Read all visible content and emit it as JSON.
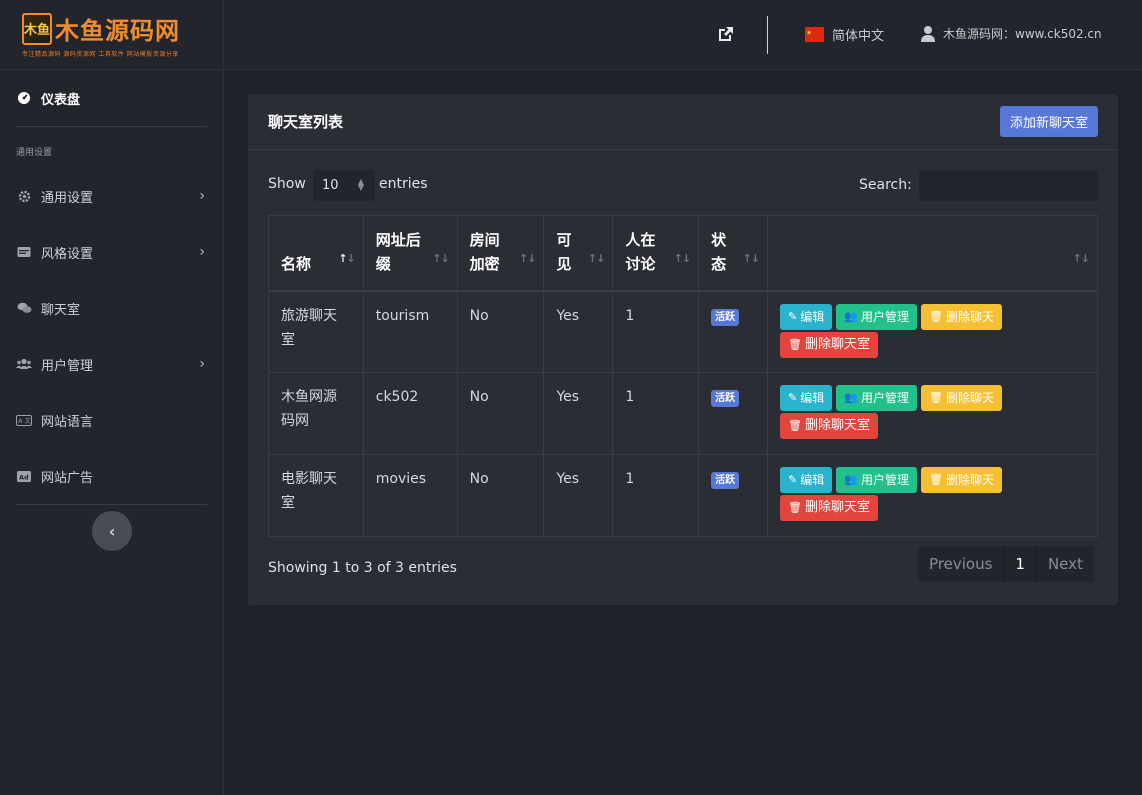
{
  "logo": {
    "badge": "木鱼",
    "text": "木鱼源码网",
    "subtitle": "专注精品源码 源码资源网 工具软件 网站模板资源分享"
  },
  "sidebar": {
    "dashboard": "仪表盘",
    "section": "通用设置",
    "items": [
      {
        "label": "通用设置",
        "icon": "gear-icon",
        "has_children": true
      },
      {
        "label": "风格设置",
        "icon": "palette-icon",
        "has_children": true
      },
      {
        "label": "聊天室",
        "icon": "chat-icon",
        "has_children": false
      },
      {
        "label": "用户管理",
        "icon": "users-icon",
        "has_children": true
      },
      {
        "label": "网站语言",
        "icon": "language-icon",
        "has_children": false
      },
      {
        "label": "网站广告",
        "icon": "ad-icon",
        "has_children": false
      }
    ],
    "collapse_glyph": "‹"
  },
  "header": {
    "language": "简体中文",
    "user": "木鱼源码网：www.ck502.cn"
  },
  "card": {
    "title": "聊天室列表",
    "add_button": "添加新聊天室"
  },
  "controls": {
    "show": "Show",
    "entries_value": "10",
    "entries": "entries",
    "search": "Search:"
  },
  "table": {
    "columns": [
      "名称",
      "网址后缀",
      "房间加密",
      "可见",
      "人在讨论",
      "状态",
      ""
    ],
    "columns_display": [
      [
        "名称"
      ],
      [
        "网址后",
        "缀"
      ],
      [
        "房间",
        "加密"
      ],
      [
        "可",
        "见"
      ],
      [
        "人在",
        "讨论"
      ],
      [
        "状",
        "态"
      ],
      [
        ""
      ]
    ],
    "rows": [
      {
        "name": [
          "旅游聊天",
          "室"
        ],
        "slug": "tourism",
        "encrypted": "No",
        "visible": "Yes",
        "online": "1",
        "status": "活跃"
      },
      {
        "name": [
          "木鱼网源",
          "码网"
        ],
        "slug": "ck502",
        "encrypted": "No",
        "visible": "Yes",
        "online": "1",
        "status": "活跃"
      },
      {
        "name": [
          "电影聊天",
          "室"
        ],
        "slug": "movies",
        "encrypted": "No",
        "visible": "Yes",
        "online": "1",
        "status": "活跃"
      }
    ],
    "actions": {
      "edit": "编辑",
      "users": "用户管理",
      "delete_chat": "删除聊天",
      "delete_room": "删除聊天室"
    }
  },
  "footer": {
    "info": "Showing 1 to 3 of 3 entries",
    "previous": "Previous",
    "page": "1",
    "next": "Next"
  },
  "colors": {
    "accent": "#5777d9",
    "edit": "#2ab3cc",
    "users": "#22c08a",
    "delete_chat": "#f5c132",
    "delete_room": "#e2453c",
    "logo": "#f08c2e"
  }
}
